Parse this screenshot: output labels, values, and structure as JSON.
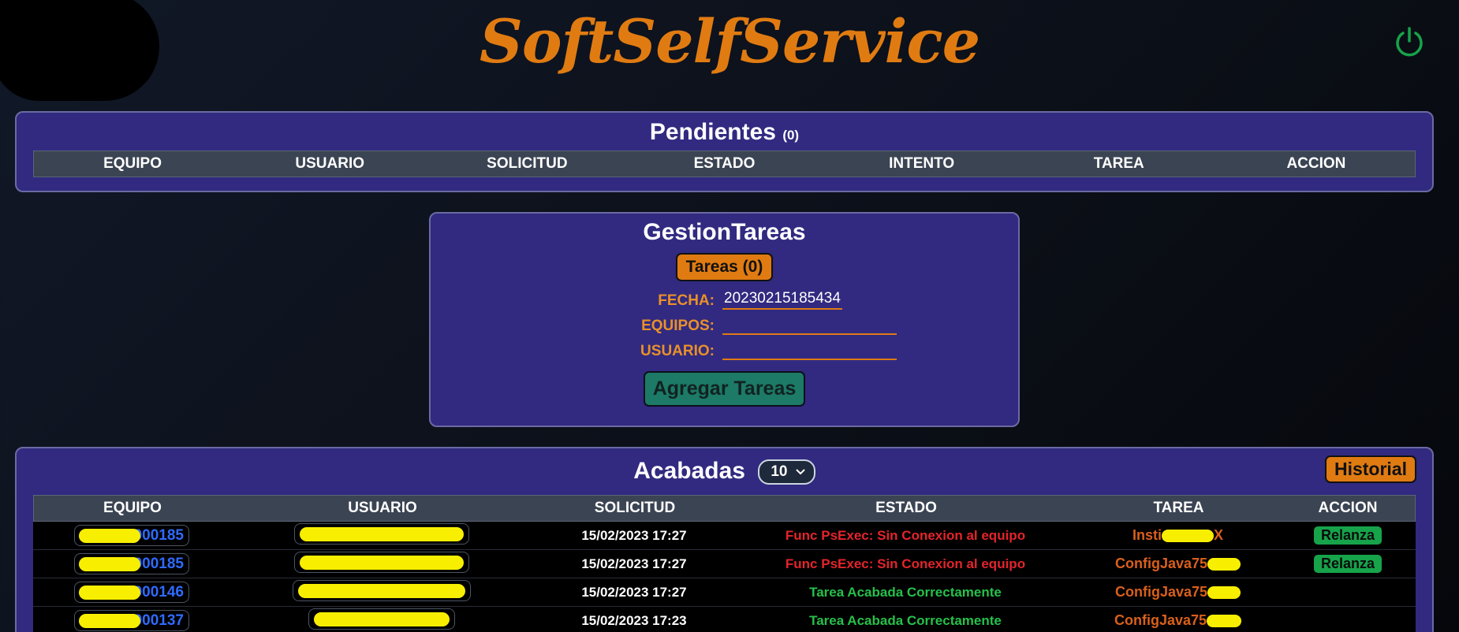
{
  "app": {
    "brand": "SoftSelfService"
  },
  "pendientes": {
    "title": "Pendientes",
    "count": "(0)",
    "columns": [
      "EQUIPO",
      "USUARIO",
      "SOLICITUD",
      "ESTADO",
      "INTENTO",
      "TAREA",
      "ACCION"
    ]
  },
  "gestion": {
    "title": "GestionTareas",
    "tareas_button": "Tareas (0)",
    "fecha_label": "FECHA:",
    "fecha_value": "20230215185434",
    "equipos_label": "EQUIPOS:",
    "equipos_value": "",
    "usuario_label": "USUARIO:",
    "usuario_value": "",
    "agregar_button": "Agregar Tareas"
  },
  "acabadas": {
    "title": "Acabadas",
    "page_size": "10",
    "historial_button": "Historial",
    "columns": [
      "EQUIPO",
      "USUARIO",
      "SOLICITUD",
      "ESTADO",
      "TAREA",
      "ACCION"
    ],
    "rows": [
      {
        "equipo": "000185",
        "solicitud": "15/02/2023 17:27",
        "estado": "Func PsExec: Sin Conexion al equipo",
        "estado_type": "error",
        "tarea": "Insti",
        "tarea_suffix": "X",
        "accion": "Relanza"
      },
      {
        "equipo": "000185",
        "solicitud": "15/02/2023 17:27",
        "estado": "Func PsExec: Sin Conexion al equipo",
        "estado_type": "error",
        "tarea": "ConfigJava75",
        "tarea_suffix": "",
        "accion": "Relanza"
      },
      {
        "equipo": "000146",
        "solicitud": "15/02/2023 17:27",
        "estado": "Tarea Acabada Correctamente",
        "estado_type": "ok",
        "tarea": "ConfigJava75",
        "tarea_suffix": "",
        "accion": ""
      },
      {
        "equipo": "000137",
        "solicitud": "15/02/2023 17:23",
        "estado": "Tarea Acabada Correctamente",
        "estado_type": "ok",
        "tarea": "ConfigJava75",
        "tarea_suffix": "",
        "accion": ""
      }
    ]
  },
  "icons": {
    "power": "power-icon",
    "select_arrow": "chevron-down-icon"
  },
  "colors": {
    "brand": "#e07b12",
    "panel": "#312a80",
    "power": "#16a34a",
    "error": "#e3242b",
    "ok": "#26c04a",
    "link": "#2f6bff"
  }
}
